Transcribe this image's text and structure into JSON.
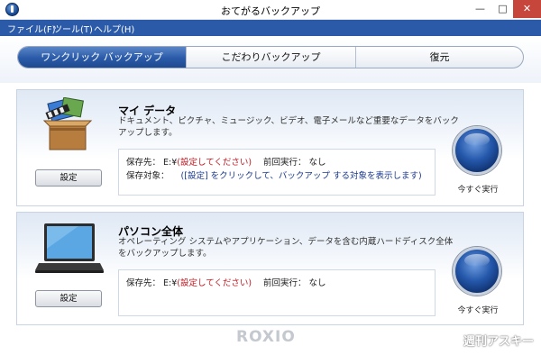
{
  "window": {
    "title": "おてがるバックアップ",
    "min": "—",
    "max": "□",
    "close": "✕"
  },
  "menu": [
    "ファイル(F)",
    "ツール(T)",
    "ヘルプ(H)"
  ],
  "tabs": [
    "ワンクリック バックアップ",
    "こだわりバックアップ",
    "復元"
  ],
  "active_tab": 0,
  "my_data": {
    "title": "マイ データ",
    "description": "ドキュメント、ピクチャ、ミュージック、ビデオ、電子メールなど重要なデータをバックアップします。",
    "dest_label": "保存先：",
    "dest_drive": "E:¥",
    "dest_status": "(設定してください)",
    "last_run_label": "前回実行：",
    "last_run_value": "なし",
    "target_label": "保存対象：",
    "target_value": "([設定] をクリックして、バックアップ する対象を表示します)",
    "settings_button": "設定",
    "run_now": "今すぐ実行"
  },
  "pc_all": {
    "title": "パソコン全体",
    "description": "オペレーティング システムやアプリケーション、データを含む内蔵ハードディスク全体をバックアップします。",
    "dest_label": "保存先：",
    "dest_drive": "E:¥",
    "dest_status": "(設定してください)",
    "last_run_label": "前回実行：",
    "last_run_value": "なし",
    "settings_button": "設定",
    "run_now": "今すぐ実行"
  },
  "brand": "ROXIO",
  "watermark": "週刊アスキー",
  "colors": {
    "menu_bar": "#2b5aa8",
    "active_tab": "#2a5aa8",
    "status_red": "#c0161e",
    "close_button": "#c7463c"
  }
}
